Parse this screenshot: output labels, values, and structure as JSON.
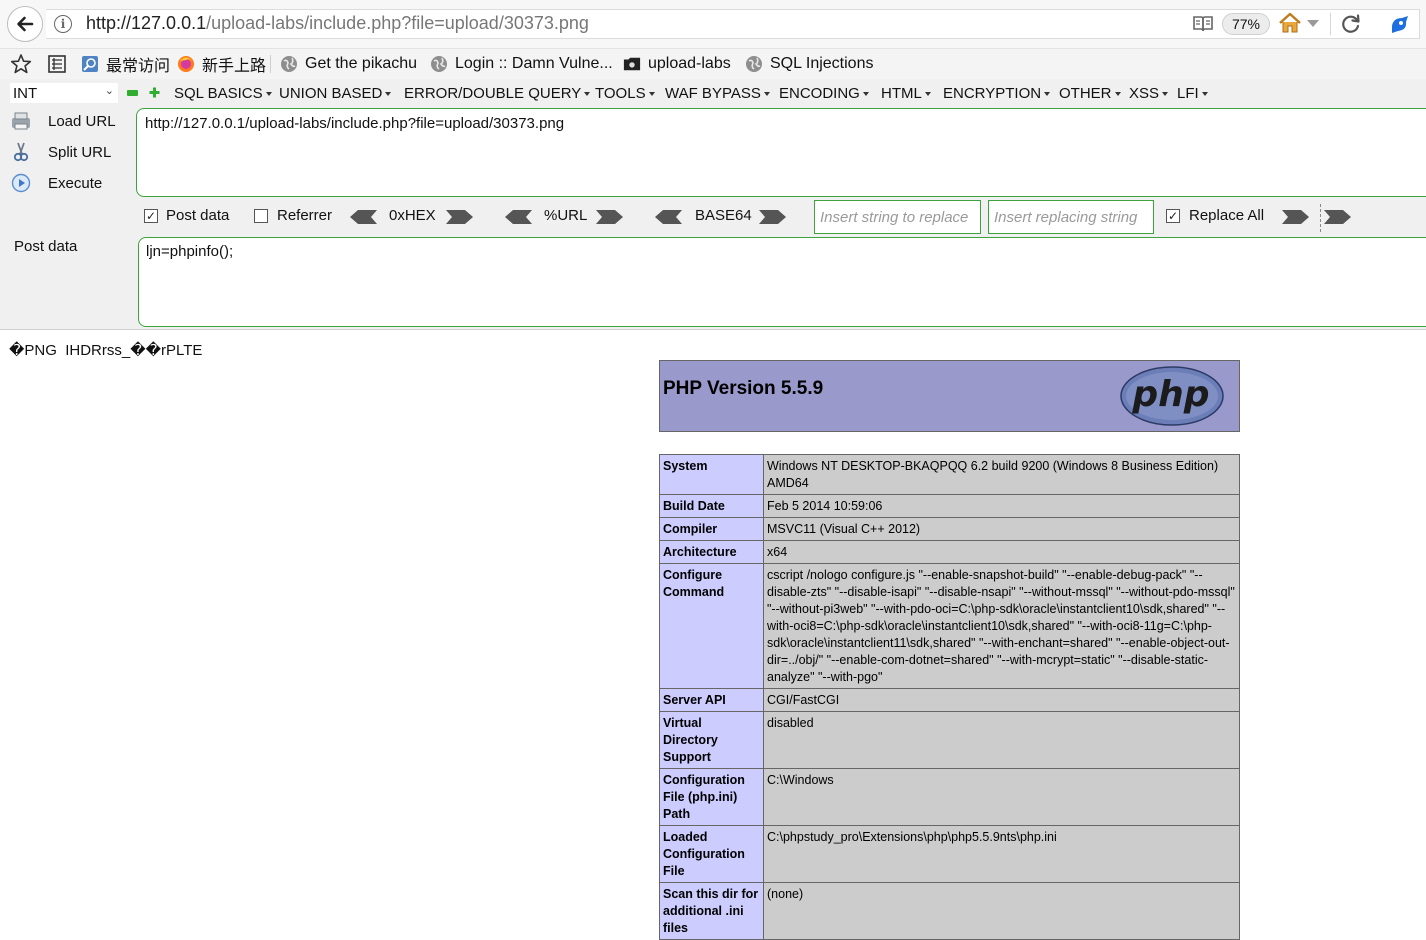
{
  "browser": {
    "url_host": "http://127.0.0.1",
    "url_path": "/upload-labs/include.php?file=upload/30373.png",
    "zoom": "77%"
  },
  "bookmarks": [
    {
      "label": "最常访问",
      "icon": "page-search-icon"
    },
    {
      "label": "新手上路",
      "icon": "firefox-icon"
    },
    {
      "label": "Get the pikachu",
      "icon": "globe-icon"
    },
    {
      "label": "Login :: Damn Vulne...",
      "icon": "globe-icon"
    },
    {
      "label": "upload-labs",
      "icon": "folder-cat-icon"
    },
    {
      "label": "SQL Injections",
      "icon": "globe-icon"
    }
  ],
  "hackbar": {
    "select_value": "INT",
    "menus": [
      "SQL BASICS",
      "UNION BASED",
      "ERROR/DOUBLE QUERY",
      "TOOLS",
      "WAF BYPASS",
      "ENCODING",
      "HTML",
      "ENCRYPTION",
      "OTHER",
      "XSS",
      "LFI"
    ],
    "load_url": "Load URL",
    "split_url": "Split URL",
    "execute": "Execute",
    "url_value": "http://127.0.0.1/upload-labs/include.php?file=upload/30373.png",
    "post_data_label": "Post data",
    "post_data_value": "ljn=phpinfo();",
    "options": {
      "post_data": {
        "label": "Post data",
        "checked": true
      },
      "referrer": {
        "label": "Referrer",
        "checked": false
      },
      "hex": "0xHEX",
      "url": "%URL",
      "base64": "BASE64",
      "replace_placeholder": "Insert string to replace",
      "replacing_placeholder": "Insert replacing string",
      "replace_all": {
        "label": "Replace All",
        "checked": true
      }
    }
  },
  "page": {
    "png_text": "�PNG  IHDRrss_��rPLTE",
    "php_version": "PHP Version 5.5.9",
    "logo_text": "php",
    "rows": [
      {
        "key": "System",
        "value": "Windows NT DESKTOP-BKAQPQQ 6.2 build 9200 (Windows 8 Business Edition) AMD64"
      },
      {
        "key": "Build Date",
        "value": "Feb 5 2014 10:59:06"
      },
      {
        "key": "Compiler",
        "value": "MSVC11 (Visual C++ 2012)"
      },
      {
        "key": "Architecture",
        "value": "x64"
      },
      {
        "key": "Configure Command",
        "value": "cscript /nologo configure.js \"--enable-snapshot-build\" \"--enable-debug-pack\" \"--disable-zts\" \"--disable-isapi\" \"--disable-nsapi\" \"--without-mssql\" \"--without-pdo-mssql\" \"--without-pi3web\" \"--with-pdo-oci=C:\\php-sdk\\oracle\\instantclient10\\sdk,shared\" \"--with-oci8=C:\\php-sdk\\oracle\\instantclient10\\sdk,shared\" \"--with-oci8-11g=C:\\php-sdk\\oracle\\instantclient11\\sdk,shared\" \"--with-enchant=shared\" \"--enable-object-out-dir=../obj/\" \"--enable-com-dotnet=shared\" \"--with-mcrypt=static\" \"--disable-static-analyze\" \"--with-pgo\""
      },
      {
        "key": "Server API",
        "value": "CGI/FastCGI"
      },
      {
        "key": "Virtual Directory Support",
        "value": "disabled"
      },
      {
        "key": "Configuration File (php.ini) Path",
        "value": "C:\\Windows"
      },
      {
        "key": "Loaded Configuration File",
        "value": "C:\\phpstudy_pro\\Extensions\\php\\php5.5.9nts\\php.ini"
      },
      {
        "key": "Scan this dir for additional .ini files",
        "value": "(none)"
      }
    ]
  },
  "colors": {
    "hackbar_border": "#3da43d",
    "php_header": "#9999cc",
    "php_key_cell": "#ccccff",
    "php_value_cell": "#cccccc"
  }
}
